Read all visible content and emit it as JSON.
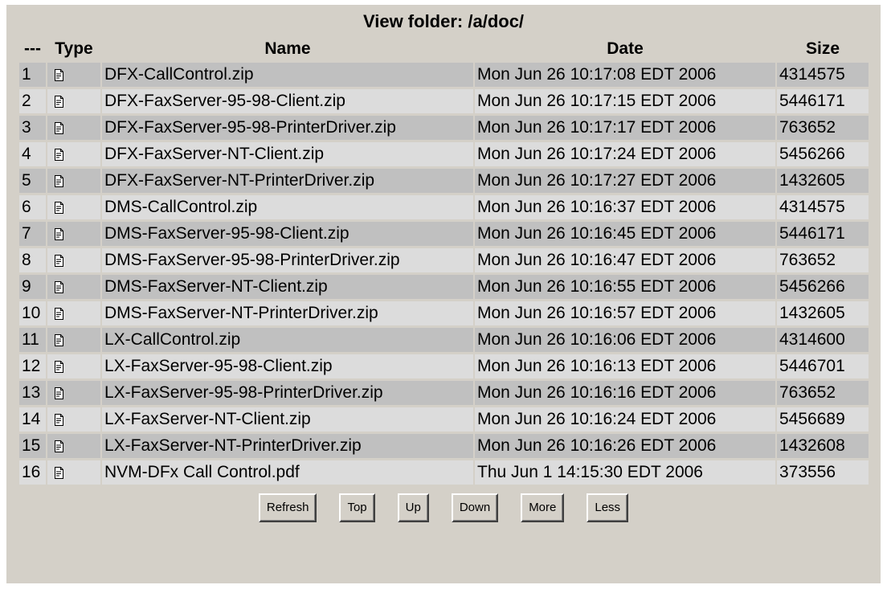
{
  "folder": {
    "title": "View folder: /a/doc/"
  },
  "table": {
    "headers": {
      "num": "---",
      "type": "Type",
      "name": "Name",
      "date": "Date",
      "size": "Size"
    },
    "rows": [
      {
        "num": "1",
        "icon": "file-icon",
        "name": "DFX-CallControl.zip",
        "date": "Mon Jun 26 10:17:08 EDT 2006",
        "size": "4314575"
      },
      {
        "num": "2",
        "icon": "file-icon",
        "name": "DFX-FaxServer-95-98-Client.zip",
        "date": "Mon Jun 26 10:17:15 EDT 2006",
        "size": "5446171"
      },
      {
        "num": "3",
        "icon": "file-icon",
        "name": "DFX-FaxServer-95-98-PrinterDriver.zip",
        "date": "Mon Jun 26 10:17:17 EDT 2006",
        "size": "763652"
      },
      {
        "num": "4",
        "icon": "file-icon",
        "name": "DFX-FaxServer-NT-Client.zip",
        "date": "Mon Jun 26 10:17:24 EDT 2006",
        "size": "5456266"
      },
      {
        "num": "5",
        "icon": "file-icon",
        "name": "DFX-FaxServer-NT-PrinterDriver.zip",
        "date": "Mon Jun 26 10:17:27 EDT 2006",
        "size": "1432605"
      },
      {
        "num": "6",
        "icon": "file-icon",
        "name": "DMS-CallControl.zip",
        "date": "Mon Jun 26 10:16:37 EDT 2006",
        "size": "4314575"
      },
      {
        "num": "7",
        "icon": "file-icon",
        "name": "DMS-FaxServer-95-98-Client.zip",
        "date": "Mon Jun 26 10:16:45 EDT 2006",
        "size": "5446171"
      },
      {
        "num": "8",
        "icon": "file-icon",
        "name": "DMS-FaxServer-95-98-PrinterDriver.zip",
        "date": "Mon Jun 26 10:16:47 EDT 2006",
        "size": "763652"
      },
      {
        "num": "9",
        "icon": "file-icon",
        "name": "DMS-FaxServer-NT-Client.zip",
        "date": "Mon Jun 26 10:16:55 EDT 2006",
        "size": "5456266"
      },
      {
        "num": "10",
        "icon": "file-icon",
        "name": "DMS-FaxServer-NT-PrinterDriver.zip",
        "date": "Mon Jun 26 10:16:57 EDT 2006",
        "size": "1432605"
      },
      {
        "num": "11",
        "icon": "file-icon",
        "name": "LX-CallControl.zip",
        "date": "Mon Jun 26 10:16:06 EDT 2006",
        "size": "4314600"
      },
      {
        "num": "12",
        "icon": "file-icon",
        "name": "LX-FaxServer-95-98-Client.zip",
        "date": "Mon Jun 26 10:16:13 EDT 2006",
        "size": "5446701"
      },
      {
        "num": "13",
        "icon": "file-icon",
        "name": "LX-FaxServer-95-98-PrinterDriver.zip",
        "date": "Mon Jun 26 10:16:16 EDT 2006",
        "size": "763652"
      },
      {
        "num": "14",
        "icon": "file-icon",
        "name": "LX-FaxServer-NT-Client.zip",
        "date": "Mon Jun 26 10:16:24 EDT 2006",
        "size": "5456689"
      },
      {
        "num": "15",
        "icon": "file-icon",
        "name": "LX-FaxServer-NT-PrinterDriver.zip",
        "date": "Mon Jun 26 10:16:26 EDT 2006",
        "size": "1432608"
      },
      {
        "num": "16",
        "icon": "file-icon",
        "name": "NVM-DFx Call Control.pdf",
        "date": "Thu Jun 1 14:15:30 EDT 2006",
        "size": "373556"
      }
    ]
  },
  "buttons": {
    "refresh": "Refresh",
    "top": "Top",
    "up": "Up",
    "down": "Down",
    "more": "More",
    "less": "Less"
  },
  "colors": {
    "panel_bg": "#d4d0c8",
    "row_dark": "#c0c0c0",
    "row_light": "#dcdcdc"
  }
}
